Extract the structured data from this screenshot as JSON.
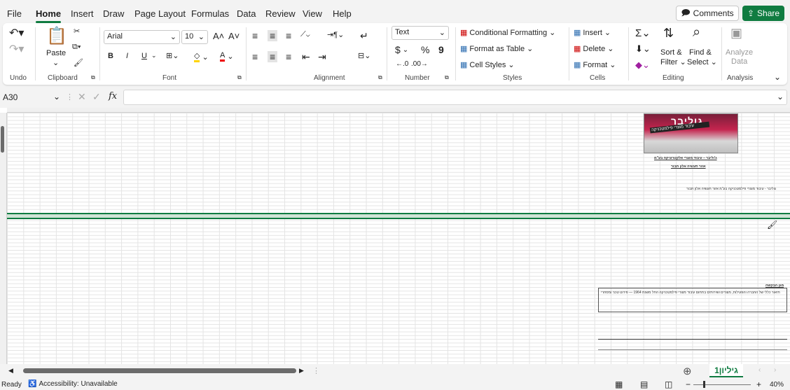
{
  "menu": {
    "tabs": [
      "File",
      "Home",
      "Insert",
      "Draw",
      "Page Layout",
      "Formulas",
      "Data",
      "Review",
      "View",
      "Help"
    ],
    "active": "Home",
    "comments_label": "Comments",
    "share_label": "Share"
  },
  "ribbon": {
    "undo": {
      "label": "Undo"
    },
    "clipboard": {
      "paste_label": "Paste",
      "label": "Clipboard"
    },
    "font": {
      "name": "Arial",
      "size": "10",
      "label": "Font",
      "bold": "B",
      "italic": "I",
      "underline": "U"
    },
    "alignment": {
      "label": "Alignment"
    },
    "number": {
      "format": "Text",
      "currency": "$",
      "percent": "%",
      "comma": "9",
      "label": "Number"
    },
    "styles": {
      "conditional": "Conditional Formatting",
      "format_table": "Format as Table",
      "cell_styles": "Cell Styles",
      "label": "Styles"
    },
    "cells": {
      "insert": "Insert",
      "delete": "Delete",
      "format": "Format",
      "label": "Cells"
    },
    "editing": {
      "sort": "Sort &",
      "sort2": "Filter",
      "find": "Find &",
      "find2": "Select",
      "label": "Editing"
    },
    "analysis": {
      "analyze": "Analyze",
      "analyze2": "Data",
      "label": "Analysis"
    }
  },
  "formula_bar": {
    "name_box": "A30",
    "fx": "fx",
    "content": ""
  },
  "sheet": {
    "logo_title": "גוליבר",
    "logo_sub": "עיבוד מוצרי פילמטכניקה",
    "company_line": "ג'וליבר – עיבוד מוצרי אלקטרוניקה בע\"מ",
    "subtitle": "אזור תעשיה אלון תבור",
    "small_note": "גוליבר - עיבוד מוצרי פילמטכניקה בע\"מ אזור תעשיה אלון תבור",
    "heading_about": "מגן הבקשה",
    "box_text": "תיאור כללי של החברה והפעילות, מוצרים ושירותים בתחום עיבוד מוצרי פילמטכניקה החל משנת 1964 — פירוט טכני ומסחרי"
  },
  "sheet_tab": "גיליון1",
  "status": {
    "ready": "Ready",
    "accessibility": "Accessibility: Unavailable",
    "zoom": "40%"
  },
  "colors": {
    "accent": "#107c41",
    "logo": "#c4244e"
  }
}
